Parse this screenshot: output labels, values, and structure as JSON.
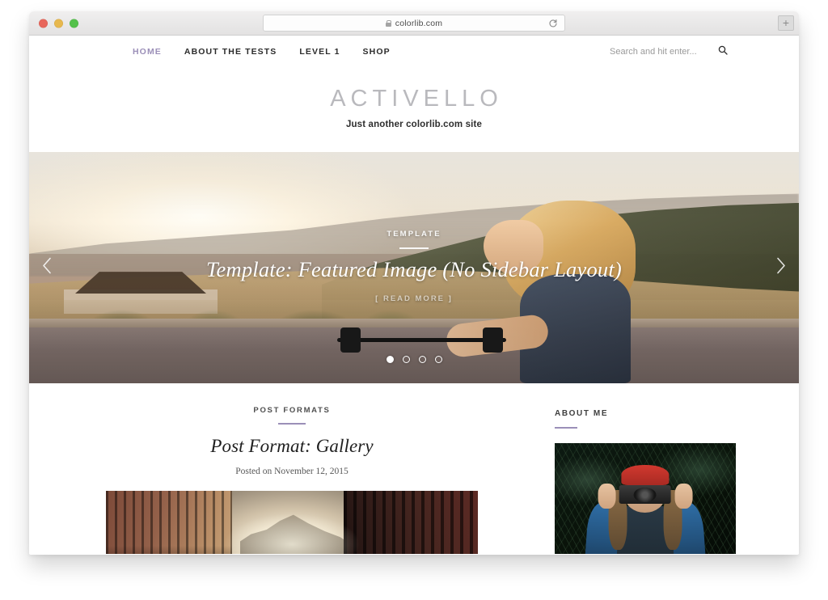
{
  "browser": {
    "url": "colorlib.com",
    "lock_icon": "lock-icon",
    "reload_icon": "reload-icon",
    "new_tab_label": "+",
    "traffic_lights": [
      "close",
      "minimize",
      "maximize"
    ]
  },
  "nav": {
    "items": [
      {
        "label": "HOME",
        "active": true
      },
      {
        "label": "ABOUT THE TESTS",
        "active": false
      },
      {
        "label": "LEVEL 1",
        "active": false
      },
      {
        "label": "SHOP",
        "active": false
      }
    ]
  },
  "search": {
    "placeholder": "Search and hit enter...",
    "icon": "search-icon"
  },
  "branding": {
    "title": "ACTIVELLO",
    "tagline": "Just another colorlib.com site"
  },
  "hero": {
    "category": "TEMPLATE",
    "title": "Template: Featured Image (No Sidebar Layout)",
    "read_more": "[ READ MORE ]",
    "prev_icon": "chevron-left-icon",
    "next_icon": "chevron-right-icon",
    "dots": [
      {
        "active": true
      },
      {
        "active": false
      },
      {
        "active": false
      },
      {
        "active": false
      }
    ]
  },
  "post": {
    "category": "POST FORMATS",
    "title": "Post Format: Gallery",
    "meta": "Posted on November 12, 2015",
    "thumbnail_alt": "city-canal-warehouses-photo"
  },
  "sidebar": {
    "widget_title": "ABOUT ME",
    "photo_alt": "photographer-with-red-beanie-photo"
  },
  "colors": {
    "accent_purple": "#9b8fb8",
    "nav_text": "#2b2b2b",
    "logo_gray": "#b9b9bd",
    "page_bg": "#ffffff"
  }
}
